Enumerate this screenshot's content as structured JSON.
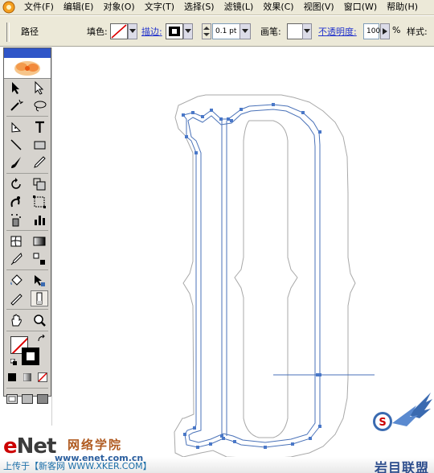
{
  "menubar": {
    "items": [
      "文件(F)",
      "编辑(E)",
      "对象(O)",
      "文字(T)",
      "选择(S)",
      "滤镜(L)",
      "效果(C)",
      "视图(V)",
      "窗口(W)",
      "帮助(H)"
    ]
  },
  "controlbar": {
    "object_type": "路径",
    "fill_label": "填色:",
    "stroke_label": "描边:",
    "stroke_weight": "0.1 pt",
    "brush_label": "画笔:",
    "opacity_label": "不透明度:",
    "opacity_value": "100",
    "percent": "%",
    "style_label": "样式:"
  },
  "tools": [
    [
      "selection-tool",
      "direct-selection-tool"
    ],
    [
      "magic-wand-tool",
      "lasso-tool"
    ],
    [
      "pen-tool",
      "type-tool"
    ],
    [
      "line-segment-tool",
      "rectangle-tool"
    ],
    [
      "paintbrush-tool",
      "pencil-tool"
    ],
    [
      "rotate-tool",
      "scale-tool"
    ],
    [
      "warp-tool",
      "free-transform-tool"
    ],
    [
      "symbol-sprayer-tool",
      "column-graph-tool"
    ],
    [
      "mesh-tool",
      "gradient-tool"
    ],
    [
      "eyedropper-tool",
      "blend-tool"
    ],
    [
      "live-paint-bucket-tool",
      "live-paint-selection-tool"
    ],
    [
      "slice-tool",
      "eraser-tool"
    ],
    [
      "hand-tool",
      "zoom-tool"
    ]
  ],
  "colors": {
    "path_blue": "#4a72b8",
    "anchor_blue": "#4a78c8",
    "outline_gray": "#a8a8a8",
    "panel_title": "#2f55c8"
  },
  "watermark": {
    "enet_e": "e",
    "enet_rest": "Net",
    "enet_cn": "网络学院",
    "url": "www.enet.com.cn",
    "upload": "上传于【新客网 WWW.XKER.COM】",
    "site": "岩目联盟",
    "badge_letter": "S"
  }
}
